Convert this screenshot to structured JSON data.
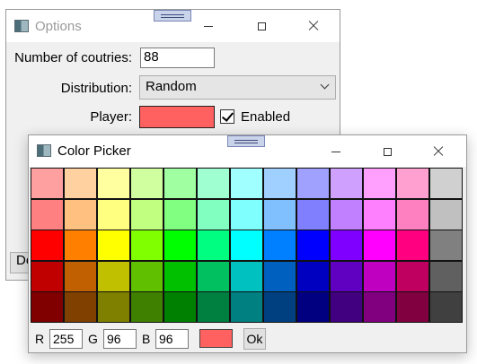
{
  "options_window": {
    "title": "Options",
    "fields": {
      "countries_label": "Number of coutries:",
      "countries_value": "88",
      "distribution_label": "Distribution:",
      "distribution_value": "Random",
      "player_label": "Player:",
      "player_color": "#ff6060",
      "enabled_label": "Enabled",
      "enabled_checked": true
    },
    "partial_button_label": "De"
  },
  "color_picker_window": {
    "title": "Color Picker",
    "palette_rows": [
      [
        "#ffa0a0",
        "#ffd0a0",
        "#ffffa0",
        "#d0ffa0",
        "#a0ffa0",
        "#a0ffd0",
        "#a0ffff",
        "#a0d0ff",
        "#a0a0ff",
        "#d0a0ff",
        "#ffa0ff",
        "#ffa0d0",
        "#d0d0d0"
      ],
      [
        "#ff8080",
        "#ffc080",
        "#ffff80",
        "#c0ff80",
        "#80ff80",
        "#80ffc0",
        "#80ffff",
        "#80c0ff",
        "#8080ff",
        "#c080ff",
        "#ff80ff",
        "#ff80c0",
        "#c0c0c0"
      ],
      [
        "#ff0000",
        "#ff8000",
        "#ffff00",
        "#80ff00",
        "#00ff00",
        "#00ff80",
        "#00ffff",
        "#0080ff",
        "#0000ff",
        "#8000ff",
        "#ff00ff",
        "#ff0080",
        "#808080"
      ],
      [
        "#c00000",
        "#c06000",
        "#c0c000",
        "#60c000",
        "#00c000",
        "#00c060",
        "#00c0c0",
        "#0060c0",
        "#0000c0",
        "#6000c0",
        "#c000c0",
        "#c00060",
        "#606060"
      ],
      [
        "#800000",
        "#804000",
        "#808000",
        "#408000",
        "#008000",
        "#008040",
        "#008080",
        "#004080",
        "#000080",
        "#400080",
        "#800080",
        "#800040",
        "#404040"
      ]
    ],
    "rgb": {
      "r_label": "R",
      "r_value": "255",
      "g_label": "G",
      "g_value": "96",
      "b_label": "B",
      "b_value": "96"
    },
    "preview_color": "#ff6060",
    "ok_label": "Ok"
  }
}
